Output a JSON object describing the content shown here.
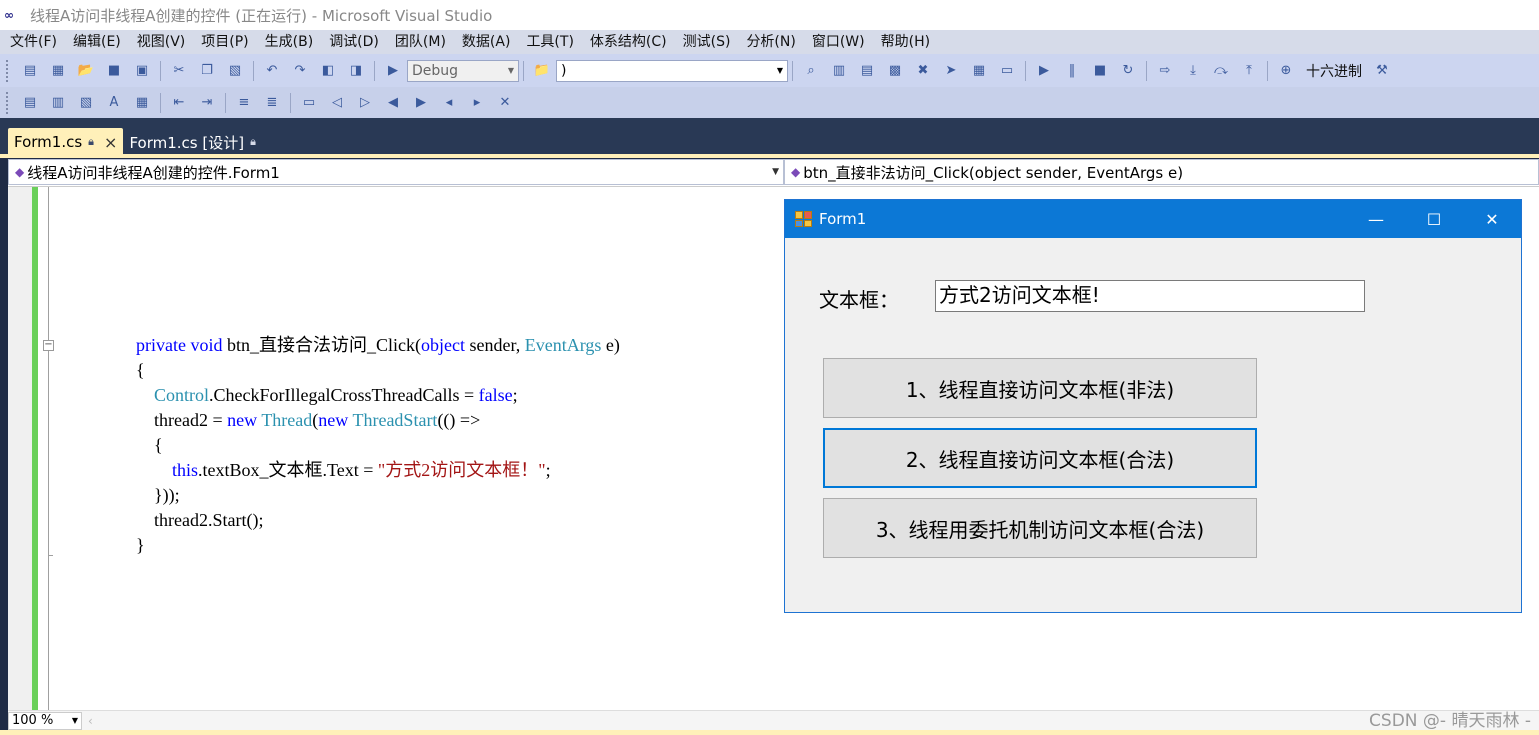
{
  "window": {
    "title": "线程A访问非线程A创建的控件 (正在运行) - Microsoft Visual Studio"
  },
  "menu": [
    "文件(F)",
    "编辑(E)",
    "视图(V)",
    "项目(P)",
    "生成(B)",
    "调试(D)",
    "团队(M)",
    "数据(A)",
    "工具(T)",
    "体系结构(C)",
    "测试(S)",
    "分析(N)",
    "窗口(W)",
    "帮助(H)"
  ],
  "toolbar": {
    "config": "Debug",
    "find_value": ")",
    "hex_label": "十六进制"
  },
  "tabs": [
    {
      "label": "Form1.cs",
      "active": true
    },
    {
      "label": "Form1.cs [设计]",
      "active": false
    }
  ],
  "nav": {
    "type_combo": "线程A访问非线程A创建的控件.Form1",
    "member_combo": "btn_直接非法访问_Click(object sender, EventArgs e)"
  },
  "code_lines": [
    "private void btn_直接合法访问_Click(object sender, EventArgs e)",
    "{",
    "Control.CheckForIllegalCrossThreadCalls = false;",
    "thread2 = new Thread(new ThreadStart(() =>",
    "{",
    "this.textBox_文本框.Text = \"方式2访问文本框！\";",
    "}));",
    "thread2.Start();",
    "}"
  ],
  "status": {
    "zoom": "100 %"
  },
  "watermark": "CSDN @- 晴天雨林 -",
  "form": {
    "title": "Form1",
    "label": "文本框：",
    "textbox_value": "方式2访问文本框!",
    "buttons": [
      "1、线程直接访问文本框(非法)",
      "2、线程直接访问文本框(合法)",
      "3、线程用委托机制访问文本框(合法)"
    ]
  },
  "colors": {
    "accent": "#0c78d6",
    "keyword": "#0000ff",
    "type": "#2b91af",
    "string": "#a31515",
    "change_bar": "#6ad05a",
    "tab_active": "#fff0b9"
  }
}
